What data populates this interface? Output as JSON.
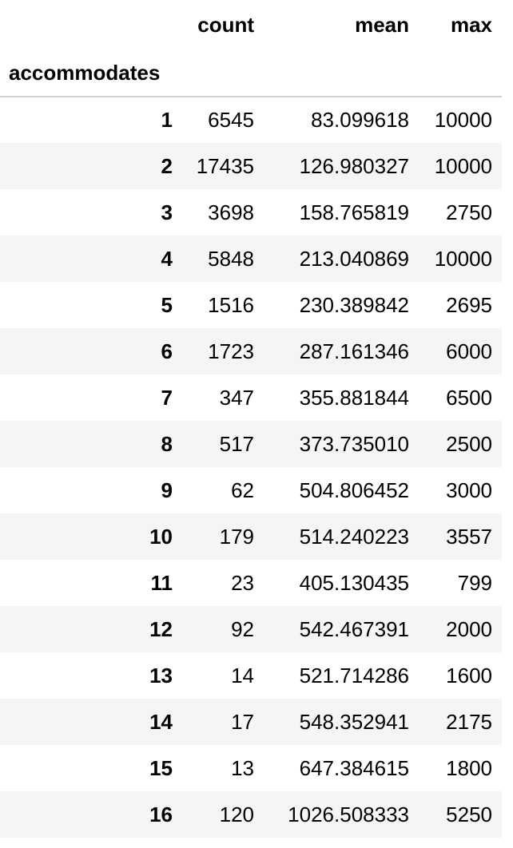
{
  "table": {
    "columns": [
      "count",
      "mean",
      "max"
    ],
    "index_name": "accommodates",
    "rows": [
      {
        "index": "1",
        "count": "6545",
        "mean": "83.099618",
        "max": "10000"
      },
      {
        "index": "2",
        "count": "17435",
        "mean": "126.980327",
        "max": "10000"
      },
      {
        "index": "3",
        "count": "3698",
        "mean": "158.765819",
        "max": "2750"
      },
      {
        "index": "4",
        "count": "5848",
        "mean": "213.040869",
        "max": "10000"
      },
      {
        "index": "5",
        "count": "1516",
        "mean": "230.389842",
        "max": "2695"
      },
      {
        "index": "6",
        "count": "1723",
        "mean": "287.161346",
        "max": "6000"
      },
      {
        "index": "7",
        "count": "347",
        "mean": "355.881844",
        "max": "6500"
      },
      {
        "index": "8",
        "count": "517",
        "mean": "373.735010",
        "max": "2500"
      },
      {
        "index": "9",
        "count": "62",
        "mean": "504.806452",
        "max": "3000"
      },
      {
        "index": "10",
        "count": "179",
        "mean": "514.240223",
        "max": "3557"
      },
      {
        "index": "11",
        "count": "23",
        "mean": "405.130435",
        "max": "799"
      },
      {
        "index": "12",
        "count": "92",
        "mean": "542.467391",
        "max": "2000"
      },
      {
        "index": "13",
        "count": "14",
        "mean": "521.714286",
        "max": "1600"
      },
      {
        "index": "14",
        "count": "17",
        "mean": "548.352941",
        "max": "2175"
      },
      {
        "index": "15",
        "count": "13",
        "mean": "647.384615",
        "max": "1800"
      },
      {
        "index": "16",
        "count": "120",
        "mean": "1026.508333",
        "max": "5250"
      }
    ]
  }
}
